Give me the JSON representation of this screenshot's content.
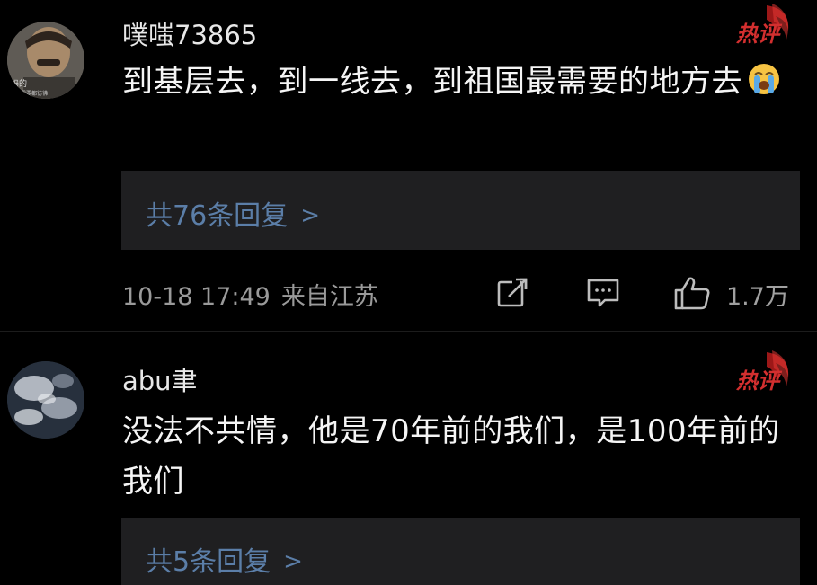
{
  "comments": [
    {
      "username": "噗嗤73865",
      "avatar_caption": "妈的",
      "avatar_caption_2": "第次需要都彷彿",
      "badge": "热评",
      "content": "到基层去，到一线去，到祖国最需要的地方去",
      "emoji": "loudly-crying-face",
      "replies": "共76条回复",
      "time": "10-18 17:49",
      "location": "来自江苏",
      "likes": "1.7万"
    },
    {
      "username": "abu聿",
      "badge": "热评",
      "content": "没法不共情，他是70年前的我们，是100年前的我们",
      "replies": "共5条回复"
    }
  ],
  "colors": {
    "background": "#000000",
    "reply_box": "#1f1f21",
    "link": "#5b7ea8",
    "badge_red": "#c62828"
  },
  "icons": {
    "chevron": "chevron-right-icon",
    "share": "share-icon",
    "comment": "comment-icon",
    "like": "thumbs-up-icon"
  }
}
